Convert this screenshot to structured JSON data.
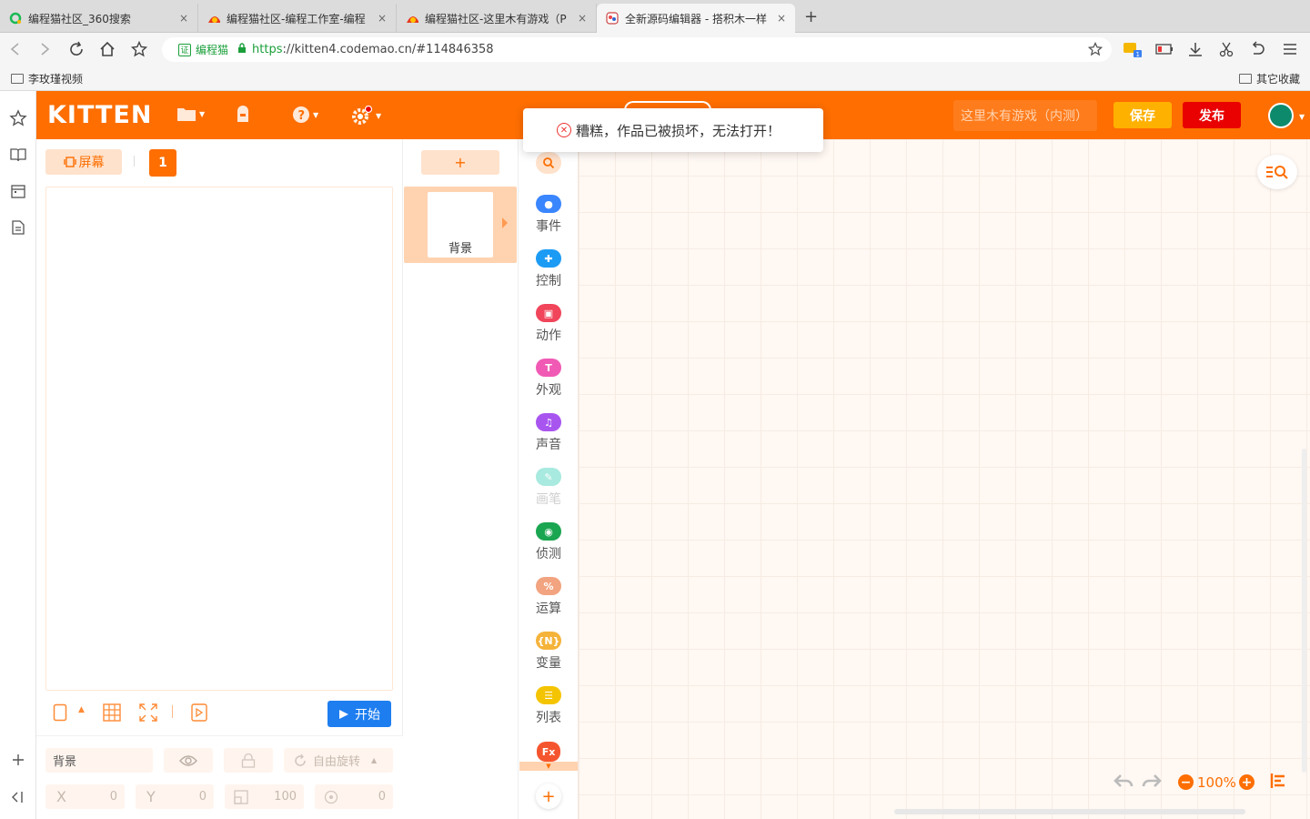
{
  "browser": {
    "tabs": [
      {
        "label": "编程猫社区_360搜索",
        "close": "×"
      },
      {
        "label": "编程猫社区-编程工作室-编程",
        "close": "×"
      },
      {
        "label": "编程猫社区-这里木有游戏（P",
        "close": "×"
      },
      {
        "label": "全新源码编辑器 - 搭积木一样",
        "close": "×"
      }
    ],
    "new_tab": "+",
    "cert_label": "编程猫",
    "cert_icon": "证",
    "url_scheme": "https",
    "url_rest": "://kitten4.codemao.cn/#114846358",
    "bookmarks": [
      "李玫瑾视频",
      "其它收藏"
    ]
  },
  "kitten": {
    "logo": "KITTEN",
    "work_name": "这里木有游戏（内测）",
    "save_label": "保存",
    "publish_label": "发布",
    "colors": {
      "brand": "#fe6e00",
      "save": "#ffb100",
      "publish": "#e90000",
      "start": "#1e7ef0",
      "avatar": "#0d8a6c"
    }
  },
  "toast": {
    "message": "糟糕，作品已被损坏，无法打开！",
    "icon": "error-circle-icon"
  },
  "stage": {
    "screen_label": "屏幕",
    "screen_index": "1",
    "start_label": "开始",
    "props": {
      "name_value": "背景",
      "rotate_label": "自由旋转",
      "x_label": "X",
      "x_value": "0",
      "y_label": "Y",
      "y_value": "0",
      "size_value": "100",
      "direction_value": "0"
    }
  },
  "sprites": {
    "add_label": "+",
    "items": [
      {
        "label": "背景"
      }
    ]
  },
  "categories": [
    {
      "label": "事件",
      "color": "#3a86ff",
      "glyph": "●"
    },
    {
      "label": "控制",
      "color": "#1c9bf5",
      "glyph": "✚"
    },
    {
      "label": "动作",
      "color": "#f0455a",
      "glyph": "▣"
    },
    {
      "label": "外观",
      "color": "#f05ab4",
      "glyph": "T"
    },
    {
      "label": "声音",
      "color": "#a855f0",
      "glyph": "♫"
    },
    {
      "label": "画笔",
      "color": "#a8eadf",
      "glyph": "✎"
    },
    {
      "label": "侦测",
      "color": "#1aa550",
      "glyph": "◉"
    },
    {
      "label": "运算",
      "color": "#f2a37f",
      "glyph": "%"
    },
    {
      "label": "变量",
      "color": "#f5b33a",
      "glyph": "{N}"
    },
    {
      "label": "列表",
      "color": "#f5c400",
      "glyph": "☰"
    }
  ],
  "category_fx": "Fx",
  "workspace": {
    "zoom": "100%"
  }
}
